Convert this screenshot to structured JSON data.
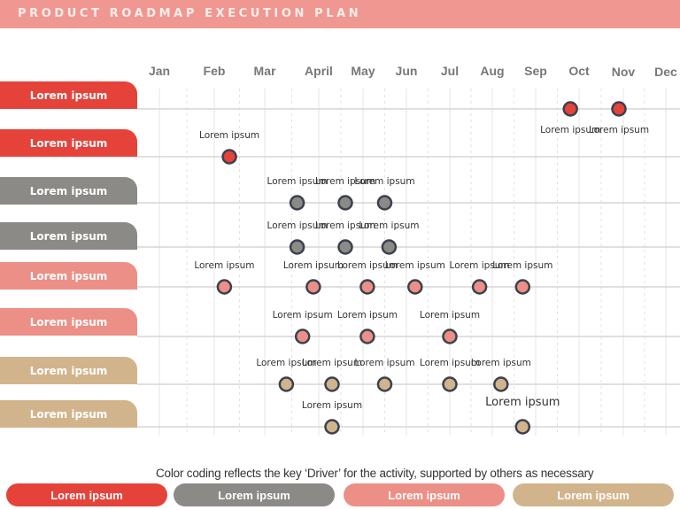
{
  "title": "PRODUCT ROADMAP EXECUTION PLAN",
  "colors": {
    "red": "#e5433a",
    "gray": "#8b8a86",
    "salmon": "#ec8f86",
    "tan": "#d2b48c",
    "dot_border": "#3c4150",
    "title_bg": "#f09791"
  },
  "months": [
    "Jan",
    "Feb",
    "Mar",
    "April",
    "May",
    "Jun",
    "Jul",
    "Aug",
    "Sep",
    "Oct",
    "Nov",
    "Dec"
  ],
  "rows": [
    {
      "label": "Lorem ipsum",
      "color": "red",
      "milestones": [
        {
          "month": 9.8,
          "label": "Lorem ipsum",
          "label_pos": "below"
        },
        {
          "month": 10.9,
          "label": "Lorem ipsum",
          "label_pos": "below"
        }
      ]
    },
    {
      "label": "Lorem ipsum",
      "color": "red",
      "milestones": [
        {
          "month": 2.3,
          "label": "Lorem ipsum",
          "label_pos": "above"
        }
      ]
    },
    {
      "label": "Lorem ipsum",
      "color": "gray",
      "milestones": [
        {
          "month": 3.6,
          "label": "Lorem ipsum",
          "label_pos": "above"
        },
        {
          "month": 4.6,
          "label": "Lorem ipsum",
          "label_pos": "above"
        },
        {
          "month": 5.5,
          "label": "Lorem ipsum",
          "label_pos": "above"
        }
      ]
    },
    {
      "label": "Lorem ipsum",
      "color": "gray",
      "milestones": [
        {
          "month": 3.6,
          "label": "Lorem ipsum",
          "label_pos": "above"
        },
        {
          "month": 4.6,
          "label": "Lorem ipsum",
          "label_pos": "above"
        },
        {
          "month": 5.6,
          "label": "Lorem ipsum",
          "label_pos": "above"
        }
      ]
    },
    {
      "label": "Lorem ipsum",
      "color": "salmon",
      "milestones": [
        {
          "month": 2.2,
          "label": "Lorem ipsum",
          "label_pos": "above"
        },
        {
          "month": 3.9,
          "label": "Lorem ipsum",
          "label_pos": "above"
        },
        {
          "month": 5.1,
          "label": "Lorem ipsum",
          "label_pos": "above"
        },
        {
          "month": 6.2,
          "label": "Lorem ipsum",
          "label_pos": "above"
        },
        {
          "month": 7.7,
          "label": "Lorem ipsum",
          "label_pos": "above"
        },
        {
          "month": 8.7,
          "label": "Lorem ipsum",
          "label_pos": "above"
        }
      ]
    },
    {
      "label": "Lorem ipsum",
      "color": "salmon",
      "milestones": [
        {
          "month": 3.7,
          "label": "Lorem ipsum",
          "label_pos": "above"
        },
        {
          "month": 5.1,
          "label": "Lorem ipsum",
          "label_pos": "above"
        },
        {
          "month": 7.0,
          "label": "Lorem ipsum",
          "label_pos": "above"
        }
      ]
    },
    {
      "label": "Lorem ipsum",
      "color": "tan",
      "milestones": [
        {
          "month": 3.4,
          "label": "Lorem ipsum",
          "label_pos": "above"
        },
        {
          "month": 4.3,
          "label": "Lorem ipsum",
          "label_pos": "above"
        },
        {
          "month": 5.5,
          "label": "Lorem ipsum",
          "label_pos": "above"
        },
        {
          "month": 7.0,
          "label": "Lorem ipsum",
          "label_pos": "above"
        },
        {
          "month": 8.2,
          "label": "Lorem ipsum",
          "label_pos": "above"
        }
      ]
    },
    {
      "label": "Lorem ipsum",
      "color": "tan",
      "milestones": [
        {
          "month": 4.3,
          "label": "Lorem ipsum",
          "label_pos": "above"
        },
        {
          "month": 8.7,
          "label": "Lorem ipsum",
          "label_pos": "above",
          "emphasis": true
        }
      ]
    }
  ],
  "footnote": "Color coding reflects the key ‘Driver’ for the activity, supported by others as necessary",
  "legend": [
    {
      "label": "Lorem ipsum",
      "color": "red"
    },
    {
      "label": "Lorem ipsum",
      "color": "gray"
    },
    {
      "label": "Lorem ipsum",
      "color": "salmon"
    },
    {
      "label": "Lorem ipsum",
      "color": "tan"
    }
  ]
}
